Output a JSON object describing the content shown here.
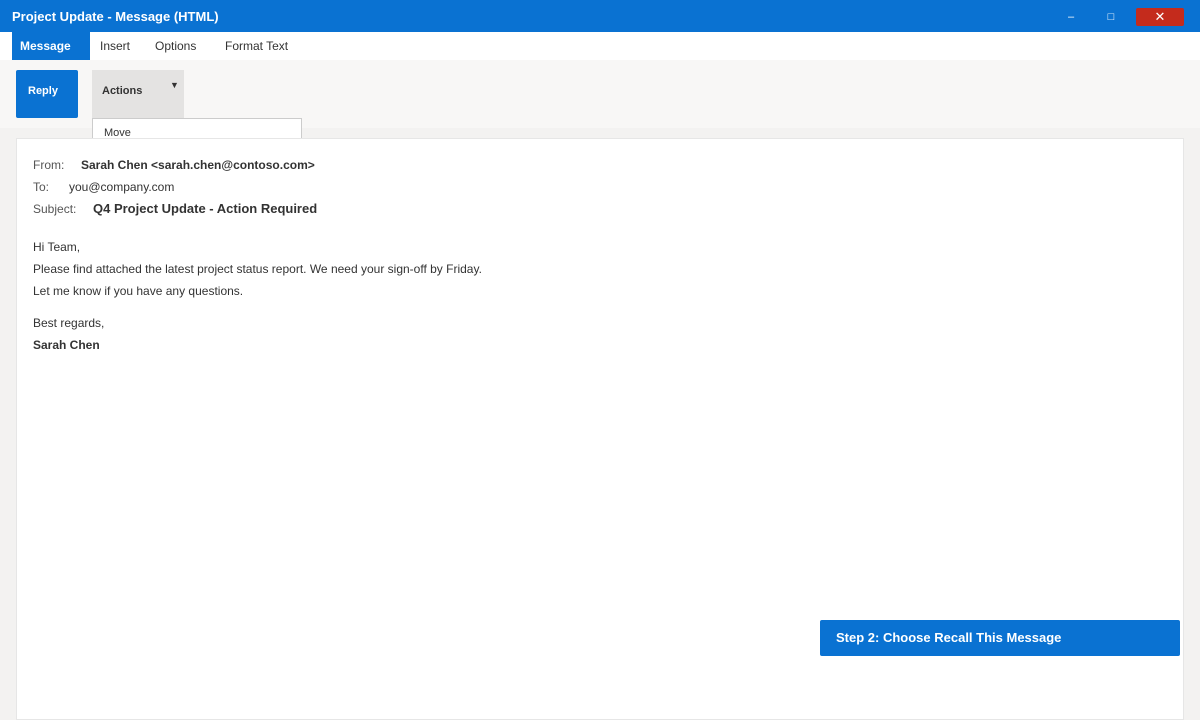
{
  "window": {
    "title": "Project Update - Message (HTML)",
    "minimize_label": "–",
    "maximize_label": "□",
    "close_label": "✕"
  },
  "tabs": [
    {
      "label": "Message",
      "active": true
    },
    {
      "label": "Insert"
    },
    {
      "label": "Options"
    },
    {
      "label": "Format Text"
    }
  ],
  "ribbon": {
    "reply_label": "Reply",
    "actions_label": "Actions",
    "actions_caret": "▼",
    "dropdown_items": [
      "Move"
    ]
  },
  "email": {
    "from_label": "From:",
    "from_value": "Sarah Chen <sarah.chen@contoso.com>",
    "to_label": "To:",
    "to_value": "you@company.com",
    "subject_label": "Subject:",
    "subject_value": "Q4 Project Update - Action Required",
    "body": [
      "Hi Team,",
      "Please find attached the latest project status report. We need your sign-off by Friday.",
      "Let me know if you have any questions."
    ],
    "closing": "Best regards,",
    "signature": "Sarah Chen"
  },
  "step_banner": "Step 2: Choose Recall This Message",
  "colors": {
    "accent": "#0a72d2",
    "close": "#c42b1c"
  }
}
